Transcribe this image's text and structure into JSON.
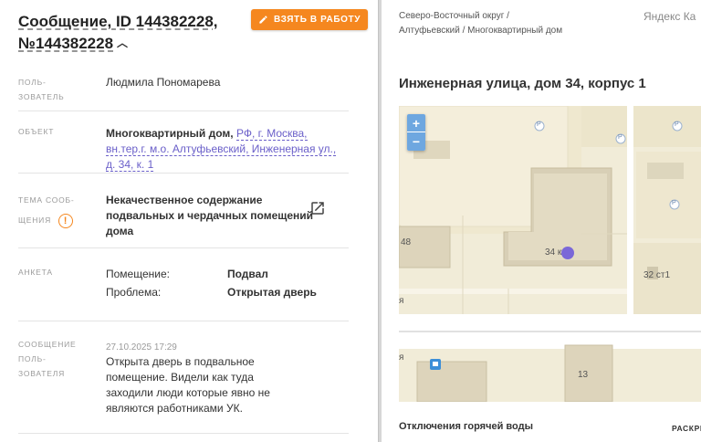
{
  "message": {
    "title": "Сообщение, ID 144382228, №144382228",
    "take_button": "ВЗЯТЬ В РАБОТУ"
  },
  "fields": {
    "user_label": "ПОЛЬ-ЗОВАТЕЛЬ",
    "user_value": "Людмила Пономарева",
    "object_label": "ОБЪЕКТ",
    "object_type": "Многоквартирный дом,",
    "object_address": "РФ, г. Москва, вн.тер.г. м.о. Алтуфьевский, Инженерная ул., д. 34, к. 1",
    "topic_label": "ТЕМА СООБ-ЩЕНИЯ",
    "topic_value": "Некачественное содержание подвальных и чердачных помещений дома",
    "survey_label": "АНКЕТА",
    "premises_label": "Помещение:",
    "premises_value": "Подвал",
    "problem_label": "Проблема:",
    "problem_value": "Открытая дверь",
    "user_msg_label": "СООБЩЕНИЕ ПОЛЬ-ЗОВАТЕЛЯ",
    "msg_date": "27.10.2025 17:29",
    "msg_text": "Открыта дверь в подвальное помещение. Видели как туда заходили люди которые явно не являются работниками УК."
  },
  "right": {
    "breadcrumbs": "Северо-Восточный округ / Алтуфьевский / Многоквартирный дом",
    "yandex": "Яндекс Ка",
    "address_title": "Инженерная улица, дом 34, корпус 1",
    "map_labels": {
      "b48": "48",
      "b34": "34 к",
      "b32": "32 ст1",
      "b13": "13",
      "ya1": "я",
      "ya2": "я",
      "p": "P"
    },
    "zoom_in": "+",
    "zoom_out": "−",
    "hot_water_title": "Отключения горячей воды",
    "expand": "РАСКРЫ"
  },
  "colors": {
    "accent": "#f5871f",
    "link": "#6a5fc9",
    "marker": "#7b68d8",
    "zoom": "#6ea7e0"
  },
  "icons": [
    "pencil-icon",
    "chevron-up-icon",
    "warning-icon",
    "external-link-icon",
    "parking-icon",
    "bus-stop-icon"
  ]
}
